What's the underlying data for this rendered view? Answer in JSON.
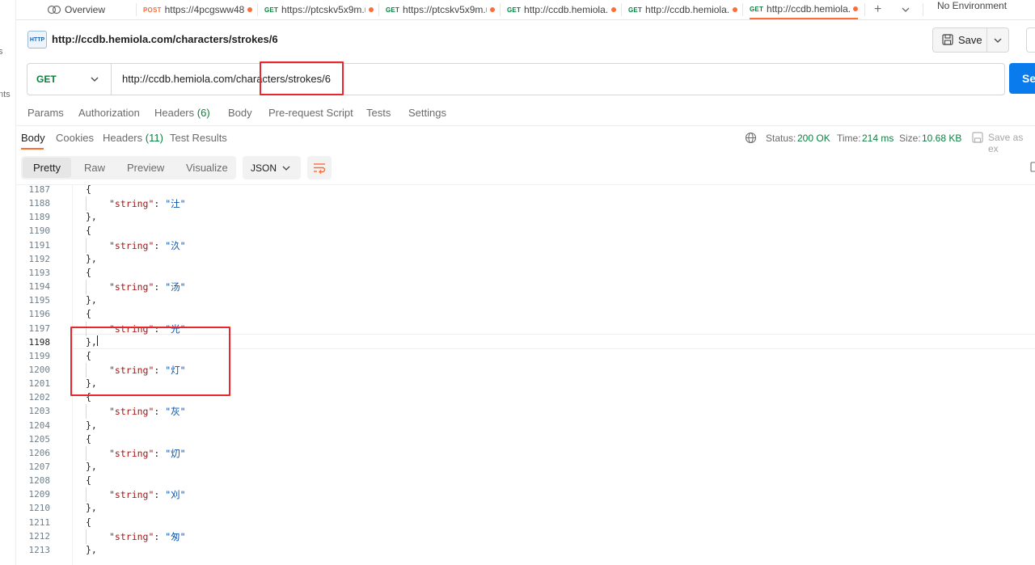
{
  "rail": {
    "frag1": "s",
    "frag2": "nts"
  },
  "tabs": [
    {
      "method": "",
      "label": "Overview",
      "icon": "overview-icon",
      "dot": false
    },
    {
      "method": "POST",
      "label": "https://4pcgsww48",
      "method_color": "#ff6c37",
      "dot": true
    },
    {
      "method": "GET",
      "label": "https://ptcskv5x9m.u",
      "method_color": "#0c8040",
      "dot": true
    },
    {
      "method": "GET",
      "label": "https://ptcskv5x9m.u",
      "method_color": "#0c8040",
      "dot": true
    },
    {
      "method": "GET",
      "label": "http://ccdb.hemiola.c",
      "method_color": "#0c8040",
      "dot": true
    },
    {
      "method": "GET",
      "label": "http://ccdb.hemiola.c",
      "method_color": "#0c8040",
      "dot": true
    },
    {
      "method": "GET",
      "label": "http://ccdb.hemiola.c",
      "method_color": "#0c8040",
      "dot": true,
      "active": true
    }
  ],
  "environment": "No Environment",
  "request": {
    "icon_text": "HTTP",
    "title": "http://ccdb.hemiola.com/characters/strokes/6",
    "save_label": "Save",
    "method": "GET",
    "url": "http://ccdb.hemiola.com/characters/strokes/6",
    "send_label": "Se"
  },
  "request_tabs": [
    {
      "label": "Params"
    },
    {
      "label": "Authorization"
    },
    {
      "label": "Headers",
      "count": "(6)"
    },
    {
      "label": "Body"
    },
    {
      "label": "Pre-request Script"
    },
    {
      "label": "Tests"
    },
    {
      "label": "Settings"
    }
  ],
  "response_tabs": [
    {
      "label": "Body",
      "active": true
    },
    {
      "label": "Cookies"
    },
    {
      "label": "Headers",
      "count": "(11)"
    },
    {
      "label": "Test Results"
    }
  ],
  "status": {
    "status_label": "Status:",
    "status_value": "200 OK",
    "time_label": "Time:",
    "time_value": "214 ms",
    "size_label": "Size:",
    "size_value": "10.68 KB",
    "save_example": "Save as ex"
  },
  "view_modes": [
    "Pretty",
    "Raw",
    "Preview",
    "Visualize"
  ],
  "format": "JSON",
  "code": {
    "key": "\"string\"",
    "lines": [
      {
        "n": "1187",
        "t": "open"
      },
      {
        "n": "1188",
        "t": "kv",
        "v": "\"汢\""
      },
      {
        "n": "1189",
        "t": "close"
      },
      {
        "n": "1190",
        "t": "open"
      },
      {
        "n": "1191",
        "t": "kv",
        "v": "\"汣\""
      },
      {
        "n": "1192",
        "t": "close"
      },
      {
        "n": "1193",
        "t": "open"
      },
      {
        "n": "1194",
        "t": "kv",
        "v": "\"汤\""
      },
      {
        "n": "1195",
        "t": "close"
      },
      {
        "n": "1196",
        "t": "open"
      },
      {
        "n": "1197",
        "t": "kv",
        "v": "\"光\""
      },
      {
        "n": "1198",
        "t": "close"
      },
      {
        "n": "1199",
        "t": "open"
      },
      {
        "n": "1200",
        "t": "kv",
        "v": "\"灯\""
      },
      {
        "n": "1201",
        "t": "close"
      },
      {
        "n": "1202",
        "t": "open"
      },
      {
        "n": "1203",
        "t": "kv",
        "v": "\"灰\""
      },
      {
        "n": "1204",
        "t": "close"
      },
      {
        "n": "1205",
        "t": "open"
      },
      {
        "n": "1206",
        "t": "kv",
        "v": "\"灱\""
      },
      {
        "n": "1207",
        "t": "close"
      },
      {
        "n": "1208",
        "t": "open"
      },
      {
        "n": "1209",
        "t": "kv",
        "v": "\"刈\""
      },
      {
        "n": "1210",
        "t": "close"
      },
      {
        "n": "1211",
        "t": "open"
      },
      {
        "n": "1212",
        "t": "kv",
        "v": "\"匆\""
      },
      {
        "n": "1213",
        "t": "close"
      }
    ]
  },
  "colors": {
    "accent": "#ff6c37",
    "send": "#097bed",
    "success": "#0c8040",
    "highlight": "#e8262b"
  }
}
